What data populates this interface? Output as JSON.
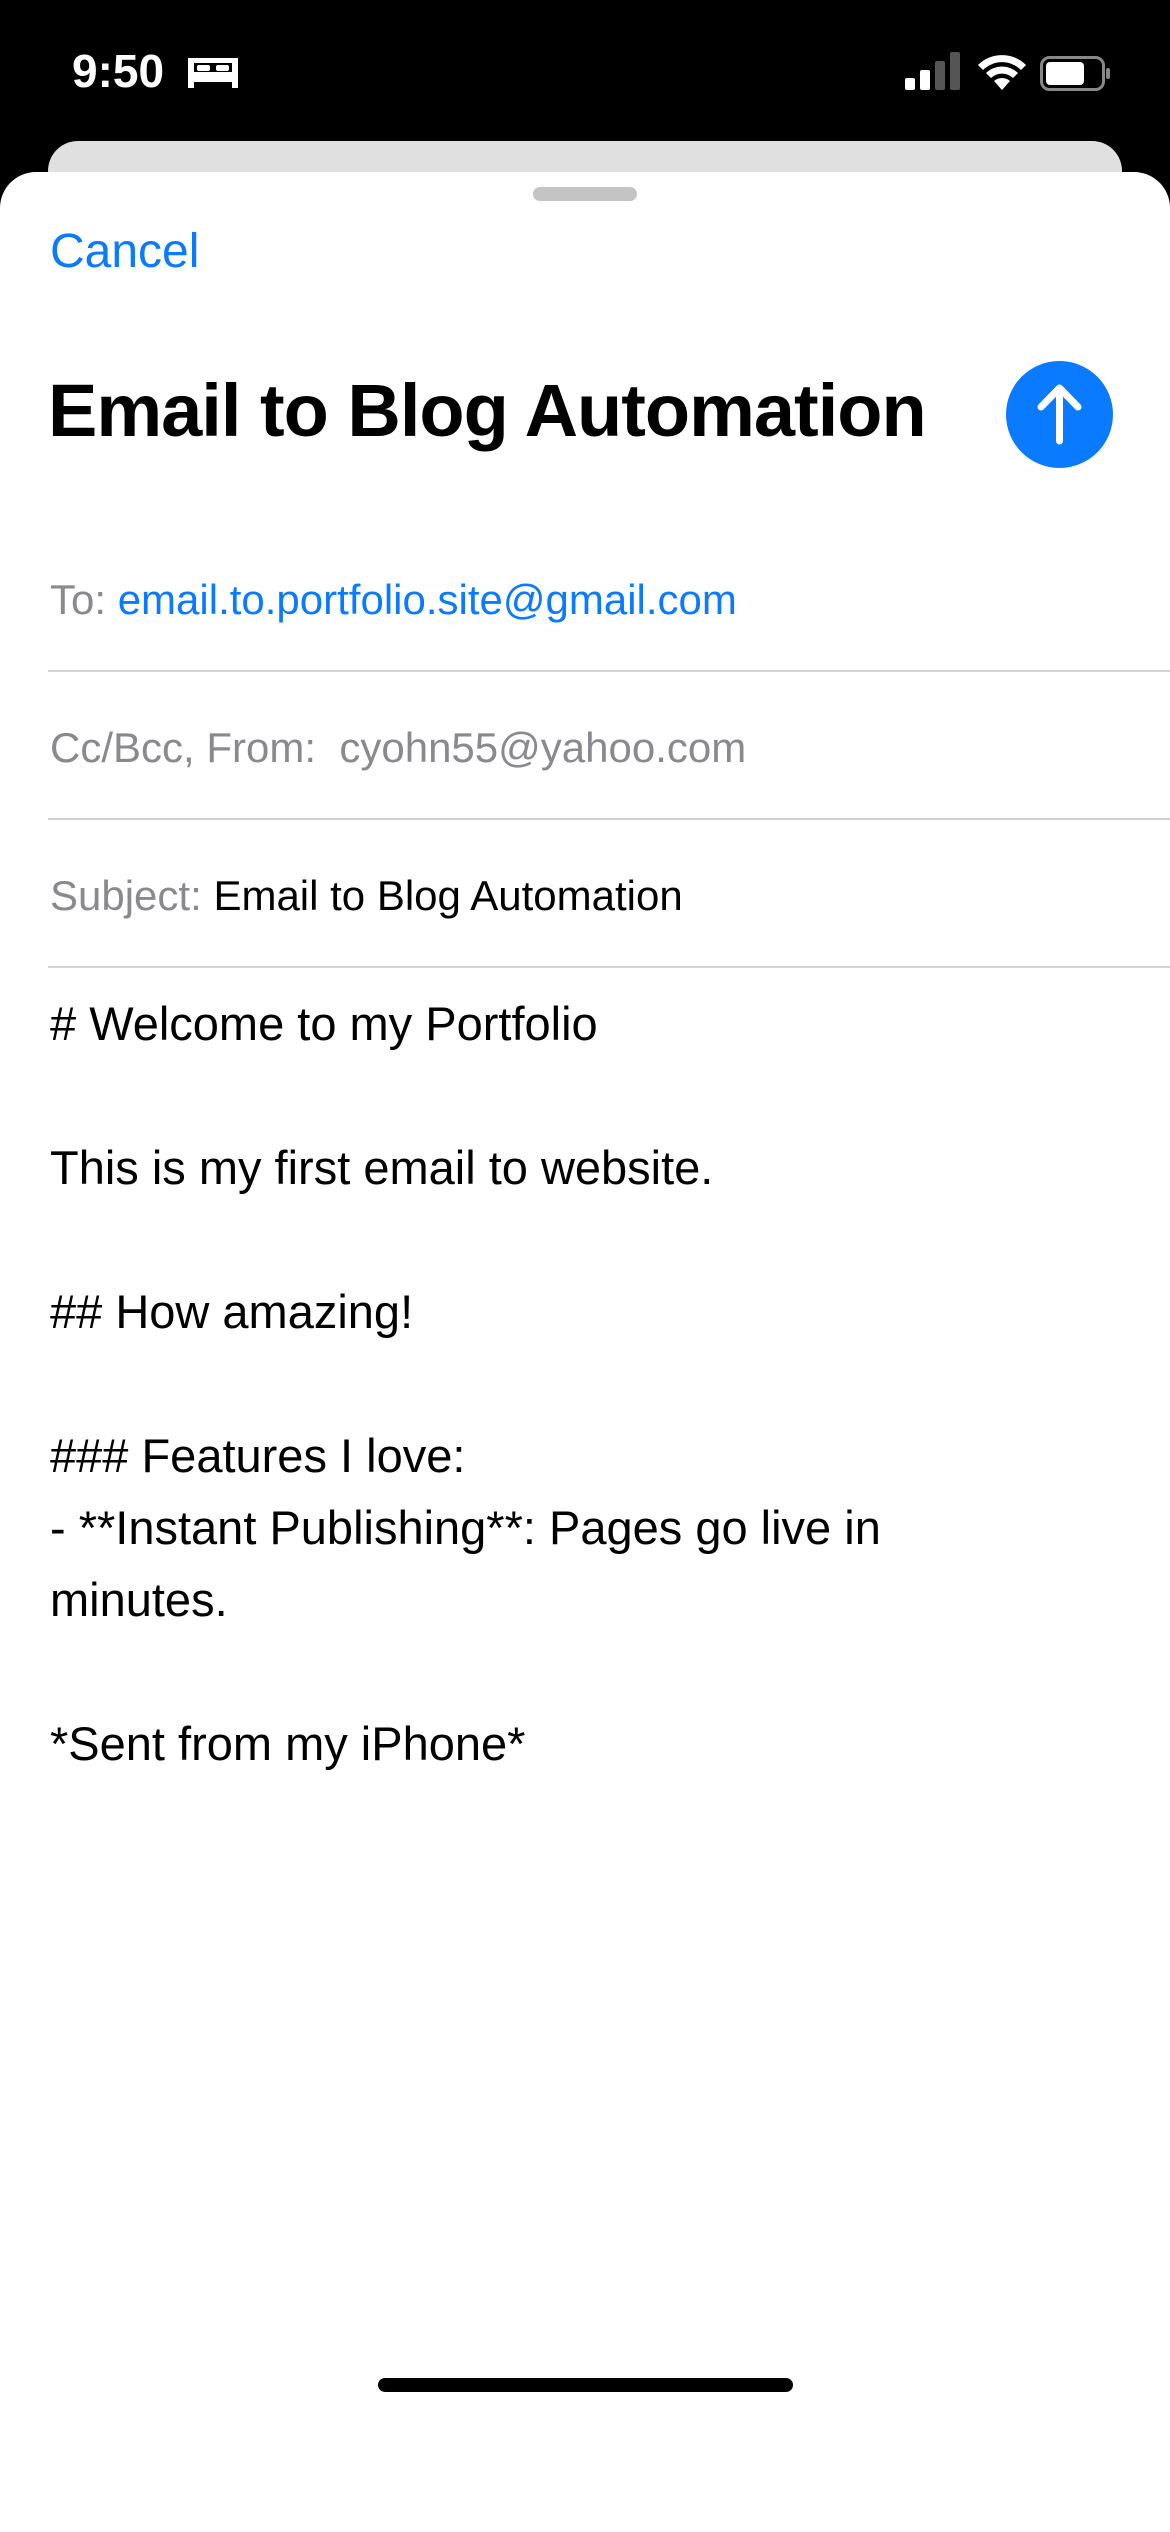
{
  "status_bar": {
    "time": "9:50",
    "focus_icon": "bed-icon",
    "signal_bars": 2,
    "battery_level": 0.7
  },
  "sheet": {
    "cancel_label": "Cancel",
    "title": "Email to Blog Automation",
    "send_icon": "arrow-up-icon",
    "accent_color": "#0a7aff"
  },
  "fields": {
    "to_label": "To:",
    "to_value": "email.to.portfolio.site@gmail.com",
    "from_label": "Cc/Bcc, From:",
    "from_value": "cyohn55@yahoo.com",
    "subject_label": "Subject:",
    "subject_value": "Email to Blog Automation"
  },
  "body": {
    "lines": [
      "# Welcome to my Portfolio",
      "",
      "This is my first email to website.",
      "",
      "## How amazing!",
      "",
      "### Features I love:",
      "- **Instant Publishing**: Pages go live in",
      "minutes.",
      "",
      "*Sent from my iPhone*"
    ]
  }
}
